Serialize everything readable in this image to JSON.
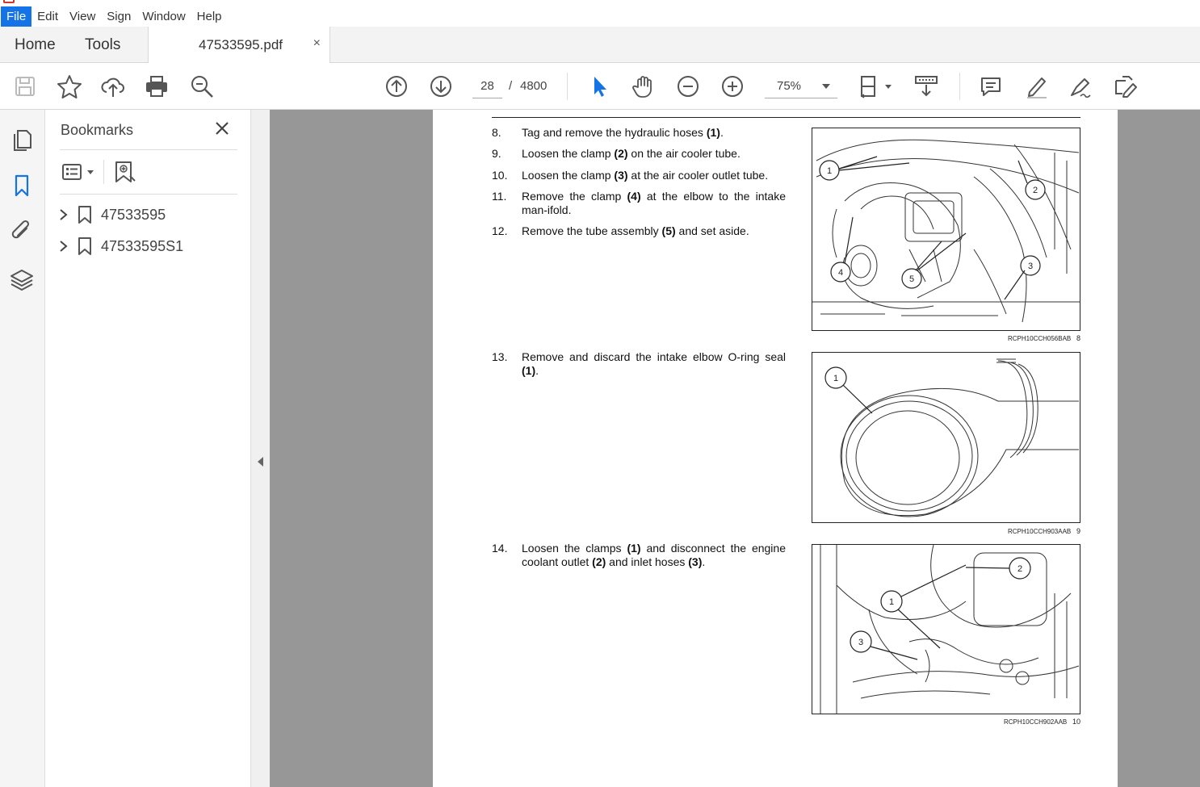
{
  "menubar": {
    "items": [
      "File",
      "Edit",
      "View",
      "Sign",
      "Window",
      "Help"
    ]
  },
  "tabs": {
    "home": "Home",
    "tools": "Tools",
    "document": "47533595.pdf",
    "close_glyph": "×"
  },
  "toolbar": {
    "current_page": "28",
    "page_separator": "/",
    "total_pages": "4800",
    "zoom": "75%"
  },
  "bookmarks_panel": {
    "title": "Bookmarks",
    "items": [
      {
        "label": "47533595"
      },
      {
        "label": "47533595S1"
      }
    ]
  },
  "document": {
    "steps": [
      {
        "num": "8.",
        "parts": [
          "Tag and remove the hydraulic hoses ",
          "(1)",
          "."
        ]
      },
      {
        "num": "9.",
        "parts": [
          "Loosen the clamp ",
          "(2)",
          " on the air cooler tube."
        ]
      },
      {
        "num": "10.",
        "parts": [
          "Loosen the clamp ",
          "(3)",
          " at the air cooler outlet tube."
        ]
      },
      {
        "num": "11.",
        "parts": [
          "Remove the clamp ",
          "(4)",
          " at the elbow to the intake man-ifold."
        ]
      },
      {
        "num": "12.",
        "parts": [
          "Remove the tube assembly ",
          "(5)",
          " and set aside."
        ]
      },
      {
        "num": "13.",
        "parts": [
          "Remove and discard the intake elbow O-ring seal ",
          "(1)",
          "."
        ]
      },
      {
        "num": "14.",
        "parts": [
          "Loosen the clamps ",
          "(1)",
          " and disconnect the engine coolant outlet ",
          "(2)",
          " and inlet hoses ",
          "(3)",
          "."
        ]
      }
    ],
    "figures": [
      {
        "code": "RCPH10CCH056BAB",
        "num": "8",
        "callouts": [
          "1",
          "2",
          "3",
          "4",
          "5"
        ]
      },
      {
        "code": "RCPH10CCH903AAB",
        "num": "9",
        "callouts": [
          "1"
        ]
      },
      {
        "code": "RCPH10CCH902AAB",
        "num": "10",
        "callouts": [
          "1",
          "2",
          "3"
        ]
      }
    ]
  },
  "colors": {
    "accent": "#1473e6",
    "doc_background": "#979797",
    "tabbar": "#f3f3f3"
  }
}
